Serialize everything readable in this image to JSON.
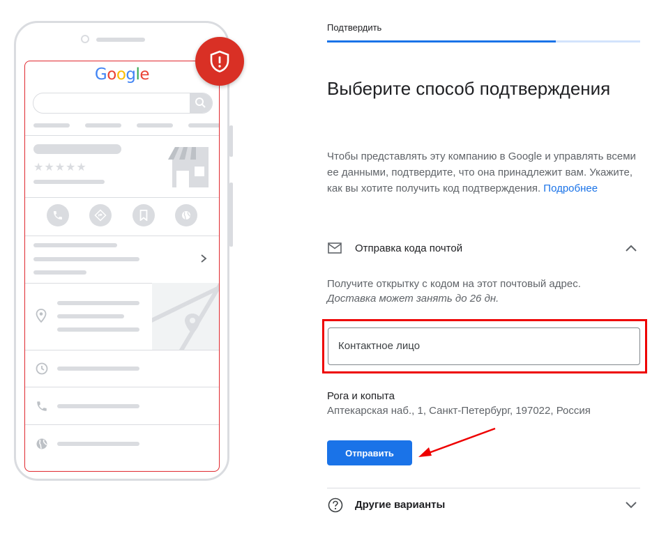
{
  "progress": {
    "label": "Подтвердить",
    "value_fraction": 0.73
  },
  "title": "Выберите способ подтверждения",
  "description": {
    "text": "Чтобы представлять эту компанию в Google и управлять всеми ее данными, подтвердите, что она принадлежит вам. Укажите, как вы хотите получить код подтверждения.",
    "link": "Подробнее"
  },
  "mail_option": {
    "label": "Отправка кода почтой",
    "icon": "mail-icon",
    "expand_icon": "chevron-up-icon",
    "info": "Получите открытку с кодом на этот почтовый адрес.",
    "delivery_note": "Доставка может занять до 26 дн.",
    "contact_placeholder": "Контактное лицо",
    "business_name": "Рога и копыта",
    "business_address": "Аптекарская наб., 1, Санкт-Петербург, 197022, Россия",
    "submit_label": "Отправить"
  },
  "other_option": {
    "label": "Другие варианты",
    "icon": "help-icon",
    "expand_icon": "chevron-down-icon"
  },
  "illustration": {
    "logo": "Google",
    "badge_icon": "shield-alert-icon"
  },
  "colors": {
    "accent": "#1a73e8",
    "alert_red": "#d93025",
    "highlight_red": "#ee0000"
  }
}
